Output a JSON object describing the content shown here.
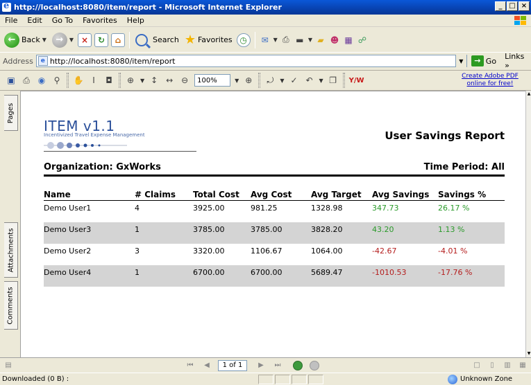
{
  "window": {
    "title": "http://localhost:8080/item/report - Microsoft Internet Explorer",
    "controls": [
      "_",
      "□",
      "×"
    ]
  },
  "menu": [
    "File",
    "Edit",
    "Go To",
    "Favorites",
    "Help"
  ],
  "toolbar": {
    "back_label": "Back",
    "search_label": "Search",
    "favorites_label": "Favorites"
  },
  "address": {
    "label": "Address",
    "url": "http://localhost:8080/item/report",
    "go_label": "Go",
    "links_label": "Links »"
  },
  "acrobat": {
    "zoom": "100%",
    "adobe_link": "Create Adobe PDF online for free!",
    "ymw": "Y/W"
  },
  "sidebar": {
    "tabs": [
      "Pages",
      "Attachments",
      "Comments"
    ]
  },
  "report": {
    "logo_title": "ITEM v1.1",
    "logo_subtitle": "Incentivized Travel Expense Management",
    "title": "User Savings Report",
    "organization_label": "Organization:",
    "organization": "GxWorks",
    "period_label": "Time Period:",
    "period": "All",
    "columns": [
      "Name",
      "# Claims",
      "Total Cost",
      "Avg Cost",
      "Avg Target",
      "Avg Savings",
      "Savings %"
    ],
    "rows": [
      {
        "name": "Demo User1",
        "claims": "4",
        "total_cost": "3925.00",
        "avg_cost": "981.25",
        "avg_target": "1328.98",
        "avg_savings": "347.73",
        "savings_pct": "26.17 %",
        "trend": "pos"
      },
      {
        "name": "Demo User3",
        "claims": "1",
        "total_cost": "3785.00",
        "avg_cost": "3785.00",
        "avg_target": "3828.20",
        "avg_savings": "43.20",
        "savings_pct": "1.13 %",
        "trend": "pos"
      },
      {
        "name": "Demo User2",
        "claims": "3",
        "total_cost": "3320.00",
        "avg_cost": "1106.67",
        "avg_target": "1064.00",
        "avg_savings": "-42.67",
        "savings_pct": "-4.01 %",
        "trend": "neg"
      },
      {
        "name": "Demo User4",
        "claims": "1",
        "total_cost": "6700.00",
        "avg_cost": "6700.00",
        "avg_target": "5689.47",
        "avg_savings": "-1010.53",
        "savings_pct": "-17.76 %",
        "trend": "neg"
      }
    ]
  },
  "nav": {
    "page_of": "1 of 1"
  },
  "status": {
    "left": "Downloaded (0 B) :",
    "zone": "Unknown Zone"
  },
  "colors": {
    "positive": "#2a9a2a",
    "negative": "#b41c1c",
    "title_bar": "#0842b0",
    "logo_blue": "#2a4f9a"
  }
}
